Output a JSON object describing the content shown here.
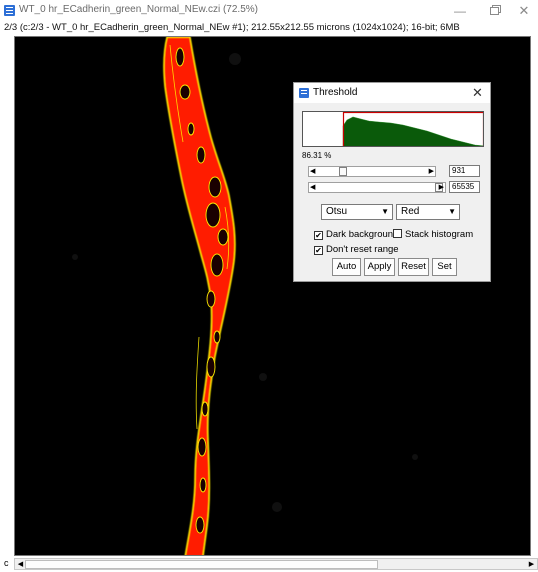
{
  "window": {
    "title": "WT_0 hr_ECadherin_green_Normal_NEw.czi (72.5%)",
    "info": "2/3 (c:2/3 - WT_0 hr_ECadherin_green_Normal_NEw #1); 212.55x212.55 microns (1024x1024); 16-bit; 6MB",
    "minimize_label": "—",
    "close_label": "✕"
  },
  "scrollbar": {
    "channel_label": "c",
    "left_arrow": "◀",
    "right_arrow": "▶"
  },
  "threshold_dialog": {
    "title": "Threshold",
    "close_label": "✕",
    "percent": "86.31 %",
    "min_value": "931",
    "max_value": "65535",
    "slider_left_arrow": "◀",
    "slider_right_arrow": "▶",
    "method": "Otsu",
    "display_mode": "Red",
    "combo_arrow": "▼",
    "dark_background_label": "Dark background",
    "dark_background_checked": "✔",
    "stack_histogram_label": "Stack histogram",
    "dont_reset_range_label": "Don't reset range",
    "dont_reset_range_checked": "✔",
    "buttons": {
      "auto": "Auto",
      "apply": "Apply",
      "reset": "Reset",
      "set": "Set"
    }
  },
  "colors": {
    "overlay_red": "#ff1a00",
    "outline_yellow": "#ffee00",
    "histogram_green": "#0a5a0a",
    "threshold_box": "#cc0000",
    "app_icon_blue": "#2d6fd6"
  }
}
